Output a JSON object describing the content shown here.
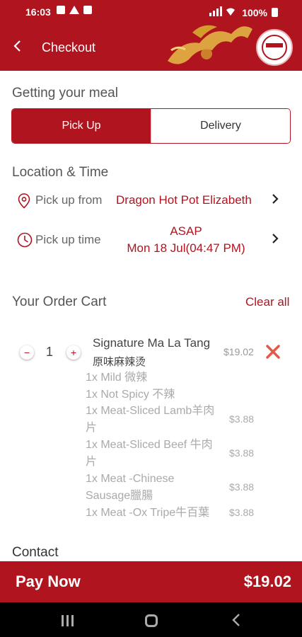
{
  "status_bar": {
    "time": "16:03",
    "battery": "100%"
  },
  "header": {
    "title": "Checkout"
  },
  "getting_meal": {
    "heading": "Getting your meal",
    "options": [
      "Pick Up",
      "Delivery"
    ],
    "selected": "Pick Up"
  },
  "location_time": {
    "heading": "Location & Time",
    "pickup_from_label": "Pick up from",
    "pickup_from_value": "Dragon Hot Pot Elizabeth",
    "pickup_time_label": "Pick up time",
    "pickup_time_value_1": "ASAP",
    "pickup_time_value_2": "Mon 18 Jul(04:47 PM)"
  },
  "cart": {
    "heading": "Your Order Cart",
    "clear_all": "Clear all",
    "items": [
      {
        "quantity": "1",
        "name": "Signature Ma La Tang",
        "name_cn": "原味麻辣烫",
        "price": "$19.02",
        "options": [
          {
            "line1": "1x Mild 微辣",
            "line2": "",
            "price": ""
          },
          {
            "line1": "1x Not Spicy 不辣",
            "line2": "",
            "price": ""
          },
          {
            "line1": "1x Meat-Sliced Lamb羊肉",
            "line2": "片",
            "price": "$3.88"
          },
          {
            "line1": "1x Meat-Sliced Beef 牛肉",
            "line2": "片",
            "price": "$3.88"
          },
          {
            "line1": "1x Meat -Chinese",
            "line2": "Sausage臘腸",
            "price": "$3.88"
          },
          {
            "line1": "1x Meat -Ox Tripe牛百葉",
            "line2": "",
            "price": "$3.88"
          }
        ]
      }
    ]
  },
  "contact": {
    "heading": "Contact"
  },
  "pay_bar": {
    "label": "Pay Now",
    "total": "$19.02"
  },
  "colors": {
    "brand": "#b0141f",
    "muted": "#aaaaaa",
    "remove": "#e05a45"
  },
  "icons": [
    "back-icon",
    "location-pin-icon",
    "clock-icon",
    "chevron-right-icon",
    "minus-icon",
    "plus-icon",
    "close-icon"
  ]
}
